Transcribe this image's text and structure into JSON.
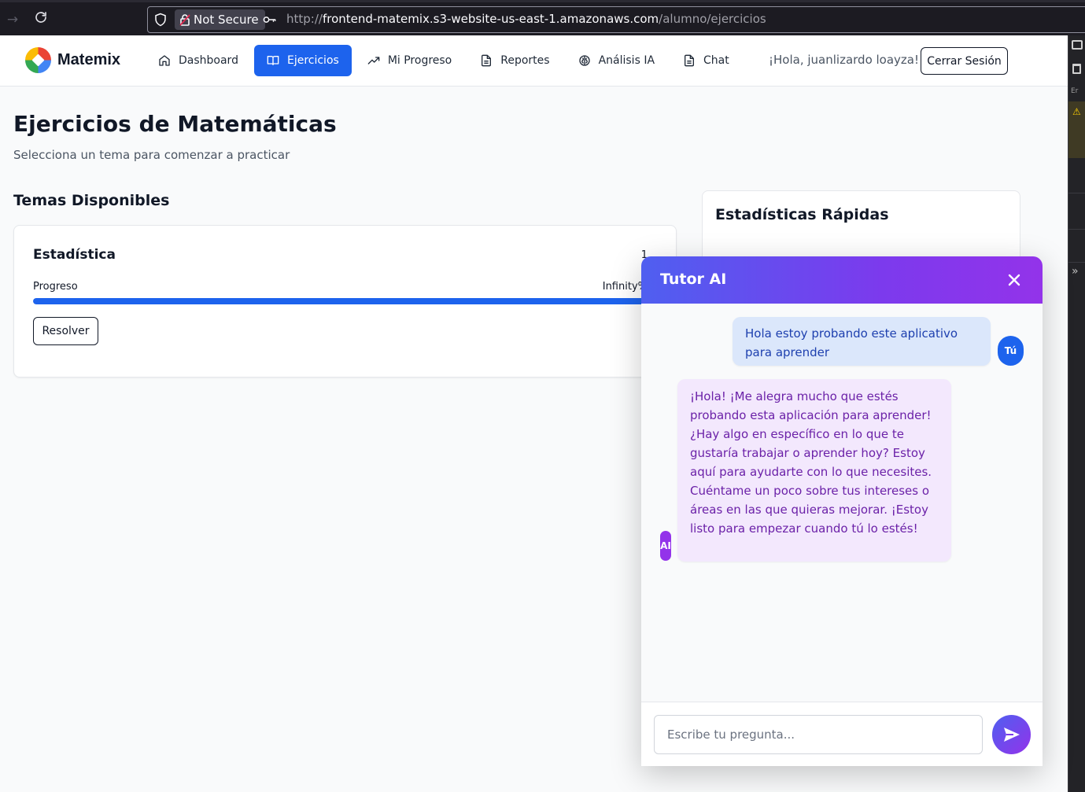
{
  "browser": {
    "security_label": "Not Secure",
    "url_scheme": "http://",
    "url_host": "frontend-matemix.s3-website-us-east-1.amazonaws.com",
    "url_path": "/alumno/ejercicios"
  },
  "devtools": {
    "label": "Er"
  },
  "header": {
    "brand": "Matemix",
    "nav": [
      {
        "label": "Dashboard",
        "icon": "home-icon"
      },
      {
        "label": "Ejercicios",
        "icon": "book-icon",
        "active": true
      },
      {
        "label": "Mi Progreso",
        "icon": "trending-up-icon"
      },
      {
        "label": "Reportes",
        "icon": "file-text-icon"
      },
      {
        "label": "Análisis IA",
        "icon": "brain-icon"
      },
      {
        "label": "Chat",
        "icon": "file-text-icon"
      }
    ],
    "greeting": "¡Hola, juanlizardo loayza!",
    "logout_label": "Cerrar Sesión"
  },
  "main": {
    "title": "Ejercicios de Matemáticas",
    "subtitle": "Selecciona un tema para comenzar a practicar",
    "topics_title": "Temas Disponibles",
    "topics": [
      {
        "name": "Estadística",
        "count": "1",
        "progress_label": "Progreso",
        "progress_value": "Infinity%",
        "progress_fraction": 1.0,
        "action_label": "Resolver"
      }
    ],
    "stats_title": "Estadísticas Rápidas"
  },
  "chat": {
    "title": "Tutor AI",
    "messages": [
      {
        "role": "user",
        "avatar": "Tú",
        "text": "Hola estoy probando este aplicativo para aprender"
      },
      {
        "role": "ai",
        "avatar": "AI",
        "text": "¡Hola! ¡Me alegra mucho que estés probando esta aplicación para aprender! ¿Hay algo en específico en lo que te gustaría trabajar o aprender hoy?  Estoy aquí para ayudarte con lo que necesites.  Cuéntame un poco sobre tus intereses o áreas en las que quieras mejorar.  ¡Estoy listo para empezar cuando tú lo estés!"
      }
    ],
    "input_placeholder": "Escribe tu pregunta..."
  },
  "colors": {
    "primary": "#1d63ed",
    "chat_gradient_start": "#4f5ff0",
    "chat_gradient_end": "#9333ea",
    "user_bubble": "#dbe7fb",
    "ai_bubble": "#f3e8fd"
  }
}
